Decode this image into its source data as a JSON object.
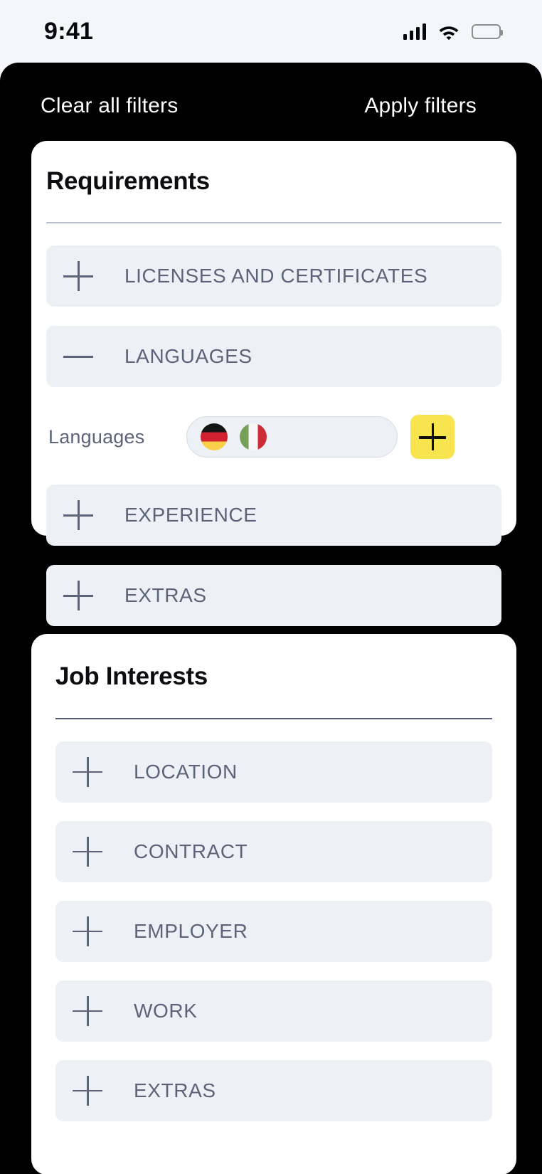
{
  "status_bar": {
    "time": "9:41",
    "signal_icon": "cellular-signal-icon",
    "wifi_icon": "wifi-icon",
    "battery_icon": "battery-full-icon"
  },
  "action_bar": {
    "clear_label": "Clear all filters",
    "apply_label": "Apply filters"
  },
  "cards": [
    {
      "title": "Requirements",
      "rows": [
        {
          "label": "LICENSES AND CERTIFICATES",
          "state": "collapsed",
          "icon": "plus-icon"
        },
        {
          "label": "LANGUAGES",
          "state": "expanded",
          "icon": "minus-icon"
        },
        {
          "label": "EXPERIENCE",
          "state": "collapsed",
          "icon": "plus-icon"
        },
        {
          "label": "EXTRAS",
          "state": "collapsed",
          "icon": "plus-icon"
        }
      ],
      "languages_field": {
        "label": "Languages",
        "placeholder": "",
        "value": "",
        "chips": [
          {
            "name": "german-flag",
            "country": "Germany"
          },
          {
            "name": "italian-flag",
            "country": "Italy"
          }
        ],
        "add_button": {
          "icon": "plus-icon",
          "color": "#f8e44f"
        }
      }
    },
    {
      "title": "Job Interests",
      "rows": [
        {
          "label": "LOCATION",
          "state": "collapsed",
          "icon": "plus-icon"
        },
        {
          "label": "CONTRACT",
          "state": "collapsed",
          "icon": "plus-icon"
        },
        {
          "label": "EMPLOYER",
          "state": "collapsed",
          "icon": "plus-icon"
        },
        {
          "label": "WORK",
          "state": "collapsed",
          "icon": "plus-icon"
        },
        {
          "label": "EXTRAS",
          "state": "collapsed",
          "icon": "plus-icon"
        }
      ]
    }
  ],
  "colors": {
    "accent_yellow": "#f8e44f",
    "panel_black": "#000000",
    "row_bg": "#edf1f5",
    "row_text": "#5b6478",
    "card_bg": "#ffffff",
    "status_bg": "#f4f6f9"
  }
}
